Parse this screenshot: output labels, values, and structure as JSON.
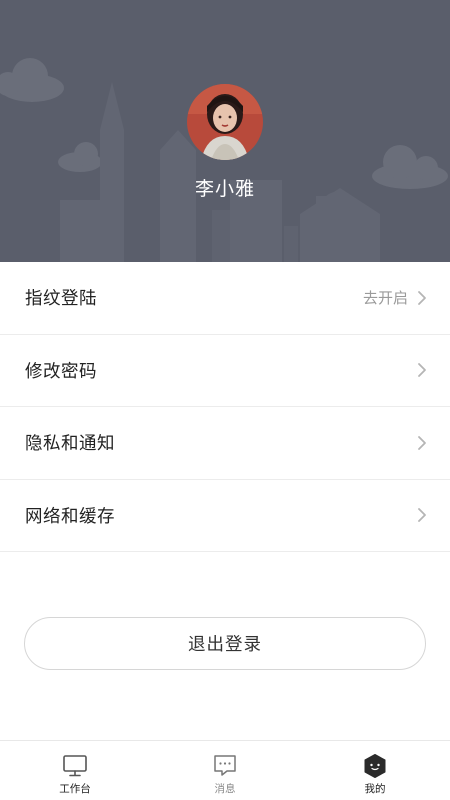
{
  "profile": {
    "username": "李小雅"
  },
  "menu": {
    "items": [
      {
        "label": "指纹登陆",
        "status": "去开启"
      },
      {
        "label": "修改密码",
        "status": ""
      },
      {
        "label": "隐私和通知",
        "status": ""
      },
      {
        "label": "网络和缓存",
        "status": ""
      }
    ]
  },
  "logout": {
    "label": "退出登录"
  },
  "tabbar": {
    "items": [
      {
        "label": "工作台",
        "icon": "monitor-icon",
        "active": false
      },
      {
        "label": "消息",
        "icon": "message-icon",
        "active": false
      },
      {
        "label": "我的",
        "icon": "profile-hexagon-icon",
        "active": true
      }
    ]
  },
  "colors": {
    "header_background": "#5a5e6b",
    "divider": "#ececec",
    "chevron": "#b5b5b5",
    "active_tab": "#222222"
  }
}
